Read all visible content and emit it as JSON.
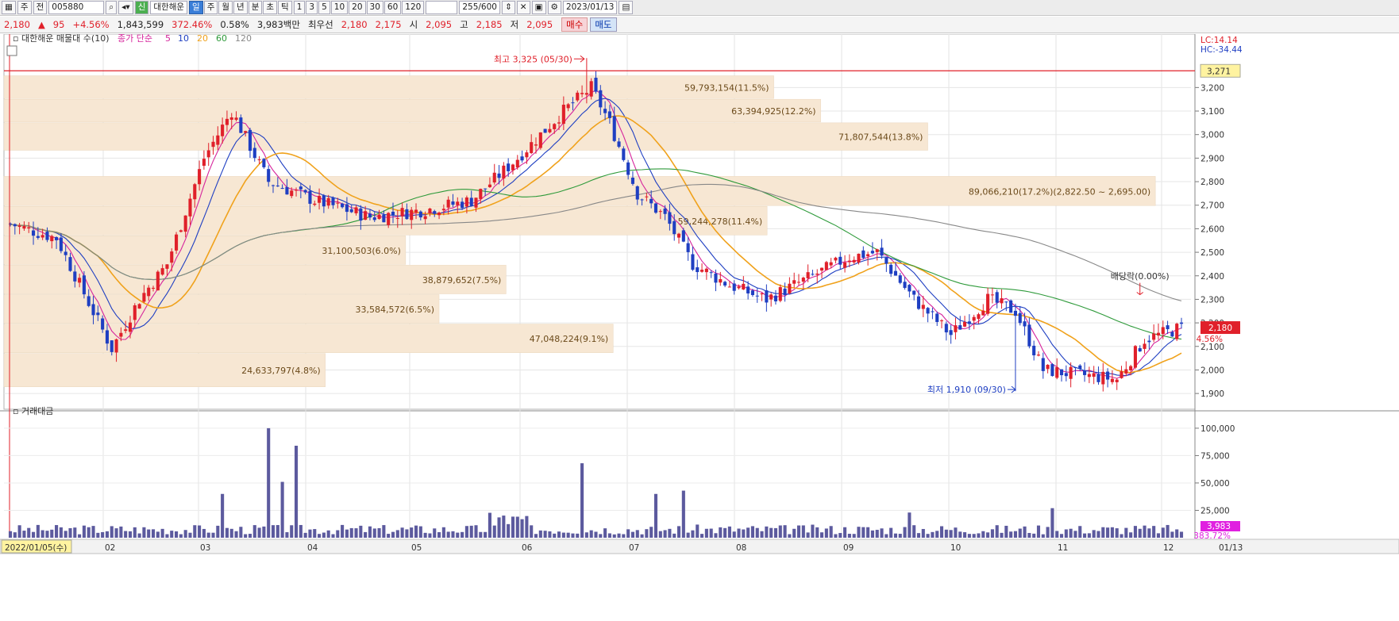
{
  "toolbar": {
    "type_label": "주",
    "market_label": "전",
    "stock_code": "005880",
    "credit_label": "신",
    "stock_name": "대한해운",
    "periods": [
      "일",
      "주",
      "월",
      "년",
      "분",
      "초",
      "틱"
    ],
    "active_period": "일",
    "intervals": [
      "1",
      "3",
      "5",
      "10",
      "20",
      "30",
      "60",
      "120"
    ],
    "count": "255",
    "count_max": "/600",
    "date": "2023/01/13"
  },
  "quote": {
    "price": "2,180",
    "change_arrow": "▲",
    "change": "95",
    "change_pct": "+4.56%",
    "volume": "1,843,599",
    "volume_ratio": "372.46%",
    "turnover": "0.58%",
    "amount": "3,983백만",
    "best_bid_label": "최우선",
    "best_ask": "2,180",
    "best_bid": "2,175",
    "open_label": "시",
    "open": "2,095",
    "high_label": "고",
    "high": "2,185",
    "low_label": "저",
    "low": "2,095",
    "buy_label": "매수",
    "sell_label": "매도"
  },
  "price_panel": {
    "title": "대한해운 매물대 수(10)",
    "ma_label": "종가 단순",
    "ma_periods": [
      "5",
      "10",
      "20",
      "60",
      "120"
    ],
    "ma_colors": [
      "#d6249c",
      "#1f3fc2",
      "#f0a21c",
      "#2e9a3a",
      "#888888"
    ],
    "lc_label": "LC:14.14",
    "hc_label": "HC:-34.44",
    "ref_label": "3,271",
    "last_price_label": "2,180",
    "last_pct_label": "4.56%",
    "high_annotation": "최고 3,325 (05/30)",
    "low_annotation": "최저 1,910 (09/30)",
    "dividend_annotation": "배당락(0.00%)",
    "y_ticks": [
      "3,200",
      "3,100",
      "3,000",
      "2,900",
      "2,800",
      "2,700",
      "2,600",
      "2,500",
      "2,400",
      "2,300",
      "2,200",
      "2,100",
      "2,000",
      "1,900"
    ]
  },
  "volume_profile": [
    {
      "label": "59,793,154(11.5%)",
      "lo": 3150,
      "hi": 3250,
      "width_pct": 11.5
    },
    {
      "label": "63,394,925(12.2%)",
      "lo": 3050,
      "hi": 3150,
      "width_pct": 12.2
    },
    {
      "label": "71,807,544(13.8%)",
      "lo": 2930,
      "hi": 3050,
      "width_pct": 13.8
    },
    {
      "label": "89,066,210(17.2%)(2,822.50 ~ 2,695.00)",
      "lo": 2695,
      "hi": 2822.5,
      "width_pct": 17.2
    },
    {
      "label": "59,244,278(11.4%)",
      "lo": 2570,
      "hi": 2695,
      "width_pct": 11.4
    },
    {
      "label": "31,100,503(6.0%)",
      "lo": 2445,
      "hi": 2570,
      "width_pct": 6.0
    },
    {
      "label": "38,879,652(7.5%)",
      "lo": 2320,
      "hi": 2445,
      "width_pct": 7.5
    },
    {
      "label": "33,584,572(6.5%)",
      "lo": 2195,
      "hi": 2320,
      "width_pct": 6.5
    },
    {
      "label": "47,048,224(9.1%)",
      "lo": 2070,
      "hi": 2195,
      "width_pct": 9.1
    },
    {
      "label": "24,633,797(4.8%)",
      "lo": 1925,
      "hi": 2070,
      "width_pct": 4.8
    }
  ],
  "volume_panel": {
    "title": "거래대금",
    "y_ticks": [
      "100,000",
      "75,000",
      "50,000",
      "25,000"
    ],
    "last_value_label": "3,983",
    "last_pct_label": "383.72%"
  },
  "x_axis": {
    "start_date_label": "2022/01/05(수)",
    "months": [
      "02",
      "03",
      "04",
      "05",
      "06",
      "07",
      "08",
      "09",
      "10",
      "11",
      "12",
      "2023/01"
    ],
    "end_label": "01/13"
  },
  "chart_data": {
    "type": "candlestick",
    "y_range": [
      1860,
      3400
    ],
    "vol_range": [
      0,
      105000
    ],
    "high_point": {
      "date": "05/30",
      "value": 3325
    },
    "low_point": {
      "date": "09/30",
      "value": 1910
    },
    "reference_line": 3271,
    "monthly_closes": {
      "01": 2100,
      "02": 2450,
      "03": 2900,
      "04": 2700,
      "05": 3200,
      "06": 2650,
      "07": 2400,
      "08": 2450,
      "09": 2000,
      "10": 1950,
      "11": 2150,
      "12": 2150,
      "2023/01": 2180
    },
    "sessions": 255
  }
}
